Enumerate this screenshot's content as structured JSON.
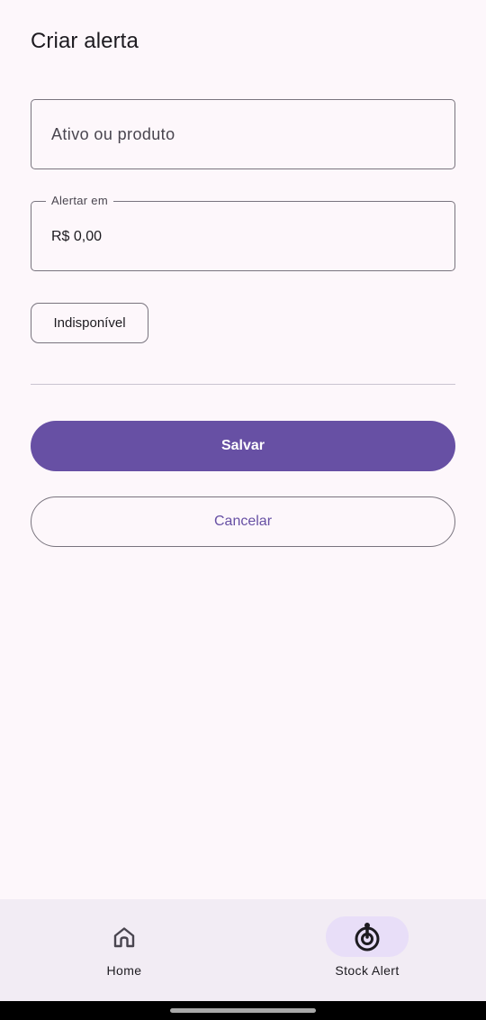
{
  "page": {
    "title": "Criar alerta"
  },
  "form": {
    "asset_field": {
      "placeholder": "Ativo ou produto"
    },
    "price_field": {
      "label": "Alertar em",
      "value": "R$ 0,00"
    },
    "chip": {
      "label": "Indisponível"
    },
    "save_button": {
      "label": "Salvar"
    },
    "cancel_button": {
      "label": "Cancelar"
    }
  },
  "bottom_nav": {
    "items": [
      {
        "label": "Home",
        "icon": "home-icon",
        "selected": false
      },
      {
        "label": "Stock Alert",
        "icon": "radar-icon",
        "selected": true
      }
    ]
  },
  "colors": {
    "primary": "#6750a4",
    "background": "#fdf7fb",
    "nav_background": "#f2ecf4",
    "nav_indicator": "#e8def8",
    "outline": "#79747e"
  }
}
